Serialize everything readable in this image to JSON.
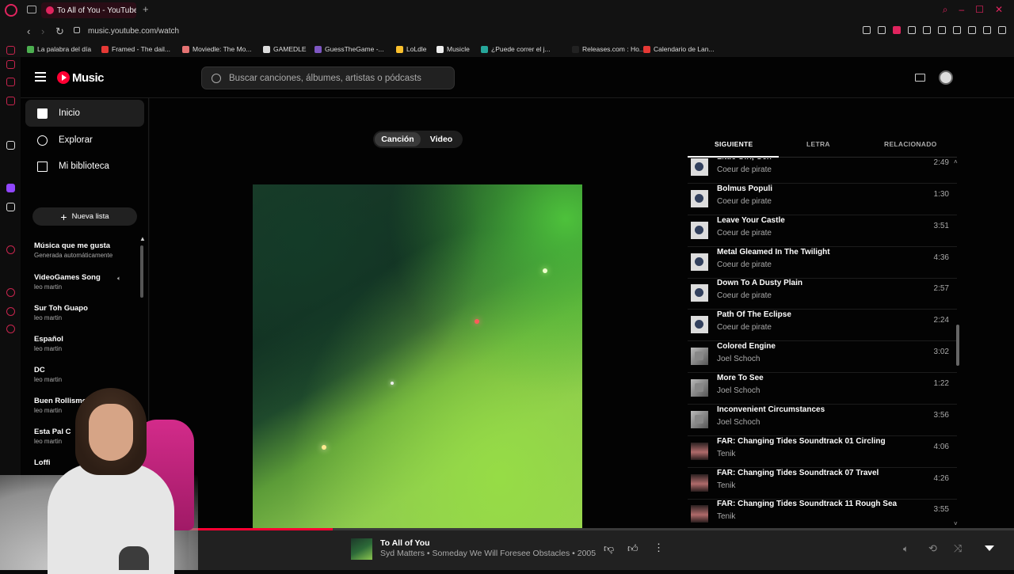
{
  "browser": {
    "tab_title": "To All of You - YouTube",
    "new_tab_symbol": "+",
    "url": "music.youtube.com/watch",
    "bookmarks": [
      {
        "label": "La palabra del día",
        "color": "#4caf50"
      },
      {
        "label": "Framed - The dail...",
        "color": "#e53935"
      },
      {
        "label": "Moviedle: The Mo...",
        "color": "#e57373"
      },
      {
        "label": "GAMEDLE",
        "color": "#dddddd"
      },
      {
        "label": "GuessTheGame -...",
        "color": "#7e57c2"
      },
      {
        "label": "LoLdle",
        "color": "#fbc02d"
      },
      {
        "label": "Musicle",
        "color": "#eeeeee"
      },
      {
        "label": "¿Puede correr el j...",
        "color": "#26a69a"
      },
      {
        "label": "Releases.com : Ho...",
        "color": "#222222"
      },
      {
        "label": "Calendario de Lan...",
        "color": "#e53935"
      }
    ]
  },
  "header": {
    "logo_text": "Music",
    "search_placeholder": "Buscar canciones, álbumes, artistas o pódcasts"
  },
  "nav": {
    "items": [
      {
        "label": "Inicio",
        "icon": "home-icon"
      },
      {
        "label": "Explorar",
        "icon": "compass-icon"
      },
      {
        "label": "Mi biblioteca",
        "icon": "library-icon"
      }
    ],
    "new_playlist": "Nueva lista"
  },
  "playlists": [
    {
      "title": "Música que me gusta",
      "subtitle": "Generada automáticamente"
    },
    {
      "title": "VideoGames Song",
      "subtitle": "leo martin"
    },
    {
      "title": "Sur Toh Guapo",
      "subtitle": "leo martin"
    },
    {
      "title": "Español",
      "subtitle": "leo martin"
    },
    {
      "title": "DC",
      "subtitle": "leo martin"
    },
    {
      "title": "Buen Rollismo",
      "subtitle": "leo martin"
    },
    {
      "title": "Esta Pal C",
      "subtitle": "leo martin"
    },
    {
      "title": "Loffi",
      "subtitle": ""
    }
  ],
  "player": {
    "toggle_song": "Canción",
    "toggle_video": "Video",
    "progress": 0.175
  },
  "queue_tabs": {
    "next": "SIGUIENTE",
    "lyrics": "LETRA",
    "related": "RELACIONADO"
  },
  "queue": [
    {
      "title": "Little Girl, Gen",
      "artist": "Coeur de pirate",
      "duration": "2:49",
      "thumb": "coeur"
    },
    {
      "title": "Bolmus Populi",
      "artist": "Coeur de pirate",
      "duration": "1:30",
      "thumb": "coeur"
    },
    {
      "title": "Leave Your Castle",
      "artist": "Coeur de pirate",
      "duration": "3:51",
      "thumb": "coeur"
    },
    {
      "title": "Metal Gleamed In The Twilight",
      "artist": "Coeur de pirate",
      "duration": "4:36",
      "thumb": "coeur"
    },
    {
      "title": "Down To A Dusty Plain",
      "artist": "Coeur de pirate",
      "duration": "2:57",
      "thumb": "coeur"
    },
    {
      "title": "Path Of The Eclipse",
      "artist": "Coeur de pirate",
      "duration": "2:24",
      "thumb": "coeur"
    },
    {
      "title": "Colored Engine",
      "artist": "Joel Schoch",
      "duration": "3:02",
      "thumb": "joel"
    },
    {
      "title": "More To See",
      "artist": "Joel Schoch",
      "duration": "1:22",
      "thumb": "joel"
    },
    {
      "title": "Inconvenient Circumstances",
      "artist": "Joel Schoch",
      "duration": "3:56",
      "thumb": "joel"
    },
    {
      "title": "FAR: Changing Tides Soundtrack 01 Circling",
      "artist": "Tenik",
      "duration": "4:06",
      "thumb": "tenik"
    },
    {
      "title": "FAR: Changing Tides Soundtrack 07 Travel",
      "artist": "Tenik",
      "duration": "4:26",
      "thumb": "tenik"
    },
    {
      "title": "FAR: Changing Tides Soundtrack 11 Rough Sea",
      "artist": "Tenik",
      "duration": "3:55",
      "thumb": "tenik"
    }
  ],
  "now_playing": {
    "title": "To All of You",
    "subtitle": "Syd Matters • Someday We Will Foresee Obstacles • 2005"
  },
  "colors": {
    "accent": "#ff0033",
    "opera": "#e0245e"
  }
}
